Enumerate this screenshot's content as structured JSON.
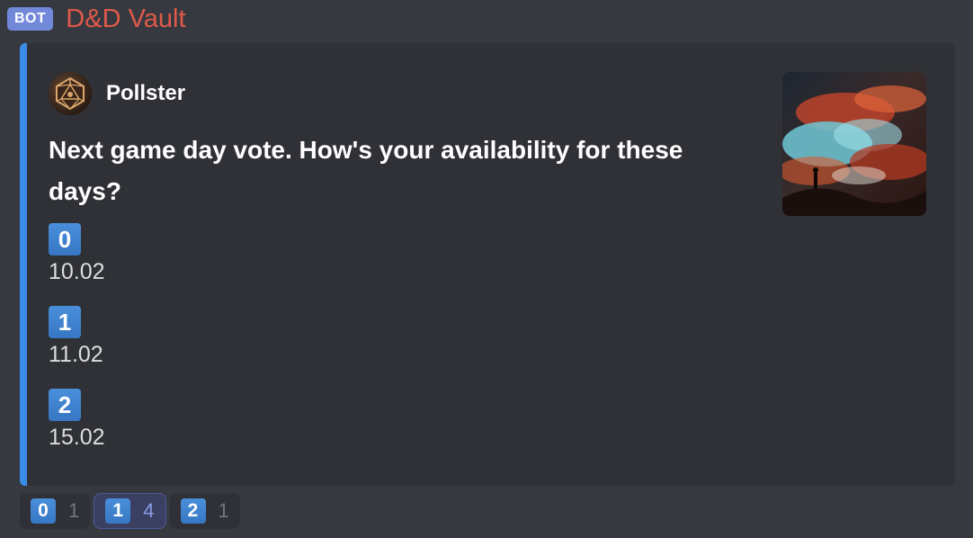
{
  "header": {
    "bot_tag": "BOT",
    "username": "D&D Vault"
  },
  "embed": {
    "author_name": "Pollster",
    "title": "Next game day vote. How's your availability for these days?",
    "options": [
      {
        "key": "0",
        "label": "10.02"
      },
      {
        "key": "1",
        "label": "11.02"
      },
      {
        "key": "2",
        "label": "15.02"
      }
    ]
  },
  "reactions": [
    {
      "key": "0",
      "count": "1",
      "active": false
    },
    {
      "key": "1",
      "count": "4",
      "active": true
    },
    {
      "key": "2",
      "count": "1",
      "active": false
    }
  ],
  "colors": {
    "accent_bar": "#3b8ce6",
    "username": "#e0594a",
    "bot_tag": "#7289da",
    "keycap": "#3f84d2"
  },
  "icons": {
    "author": "d20-dice-icon",
    "thumbnail": "fantasy-landscape-image"
  }
}
